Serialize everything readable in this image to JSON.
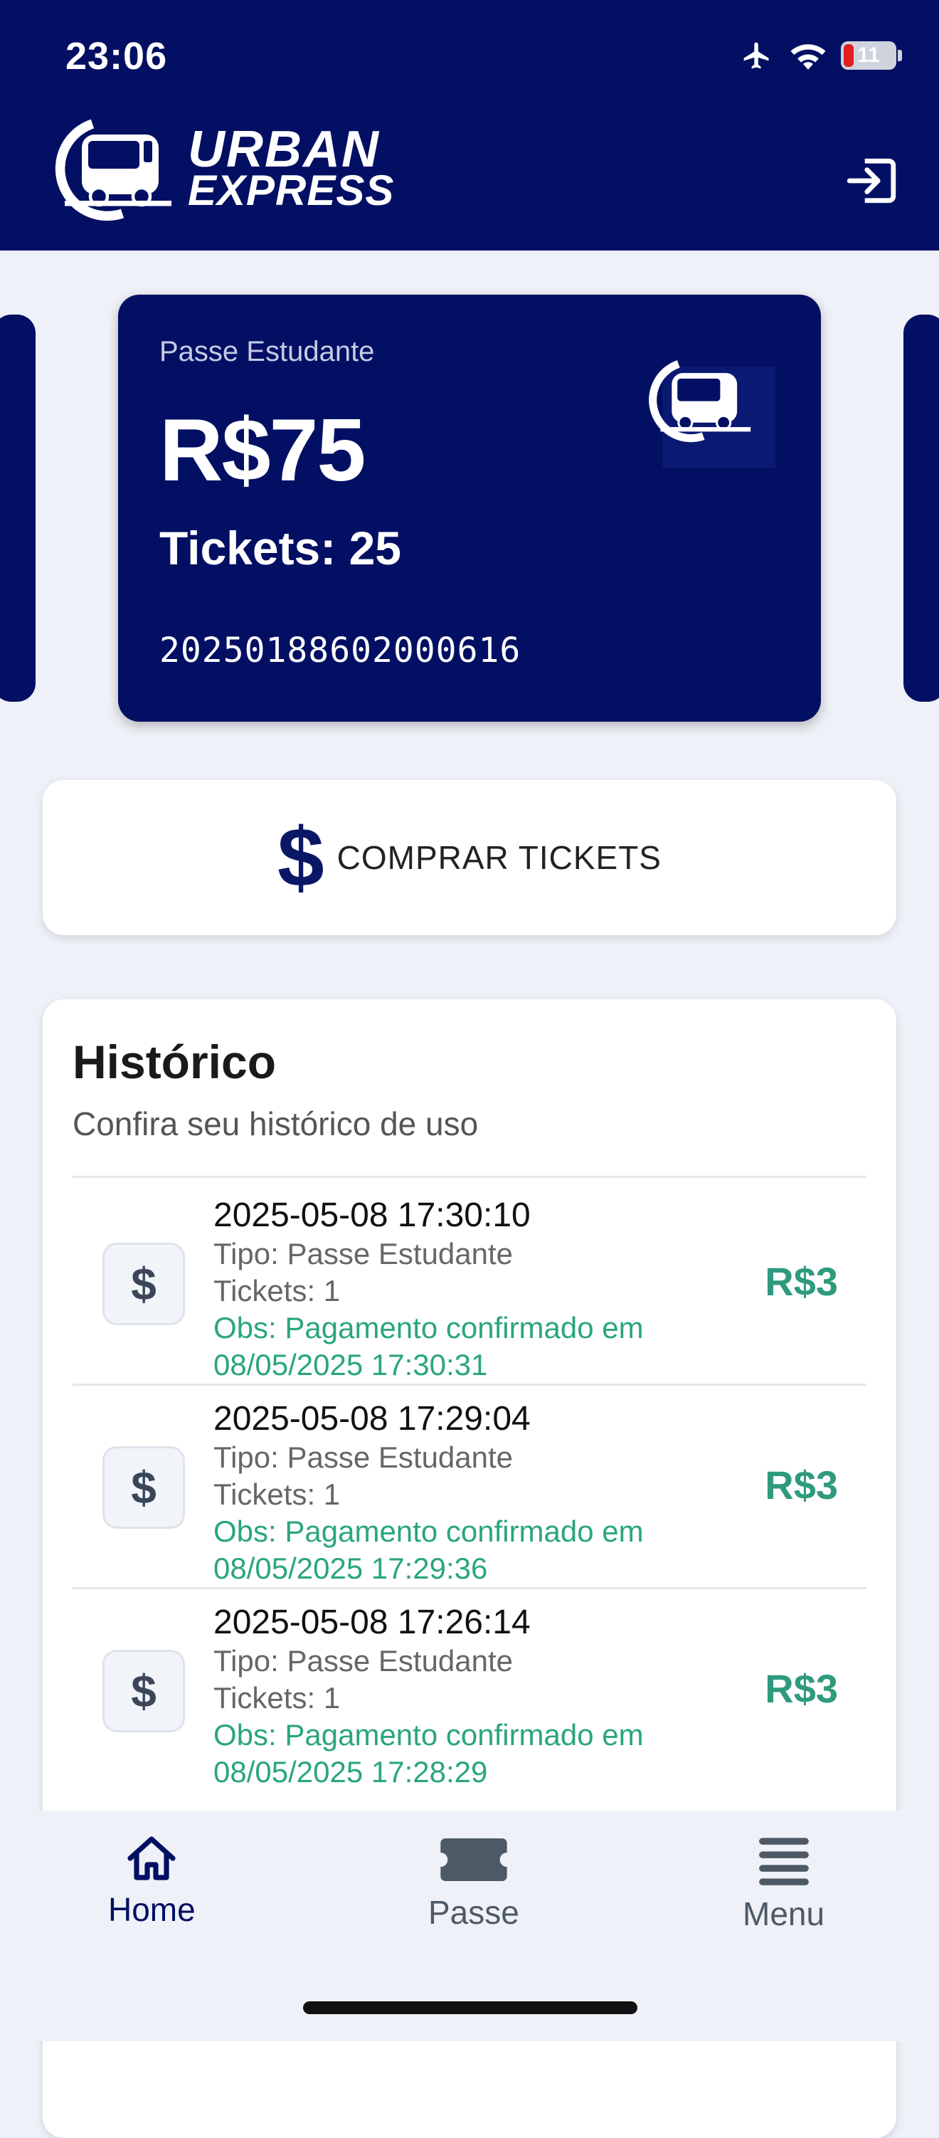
{
  "status_bar": {
    "time": "23:06",
    "battery": "11"
  },
  "header": {
    "logo_line1": "URBAN",
    "logo_line2": "EXPRESS"
  },
  "pass_card": {
    "type": "Passe Estudante",
    "amount": "R$75",
    "tickets": "Tickets: 25",
    "number": "20250188602000616"
  },
  "buy_button": {
    "icon": "$",
    "label": "COMPRAR TICKETS"
  },
  "history": {
    "title": "Histórico",
    "subtitle": "Confira seu histórico de uso",
    "items": [
      {
        "icon": "$",
        "datetime": "2025-05-08 17:30:10",
        "type": "Tipo: Passe Estudante",
        "tickets": "Tickets: 1",
        "obs": "Obs: Pagamento confirmado em 08/05/2025 17:30:31",
        "value": "R$3"
      },
      {
        "icon": "$",
        "datetime": "2025-05-08 17:29:04",
        "type": "Tipo: Passe Estudante",
        "tickets": "Tickets: 1",
        "obs": "Obs: Pagamento confirmado em 08/05/2025 17:29:36",
        "value": "R$3"
      },
      {
        "icon": "$",
        "datetime": "2025-05-08 17:26:14",
        "type": "Tipo: Passe Estudante",
        "tickets": "Tickets: 1",
        "obs": "Obs: Pagamento confirmado em 08/05/2025 17:28:29",
        "value": "R$3"
      }
    ]
  },
  "nav": {
    "home": "Home",
    "pass": "Passe",
    "menu": "Menu",
    "active": "home"
  },
  "colors": {
    "primary": "#020f63",
    "success": "#2f9a7d",
    "inactive": "#4e5966"
  }
}
